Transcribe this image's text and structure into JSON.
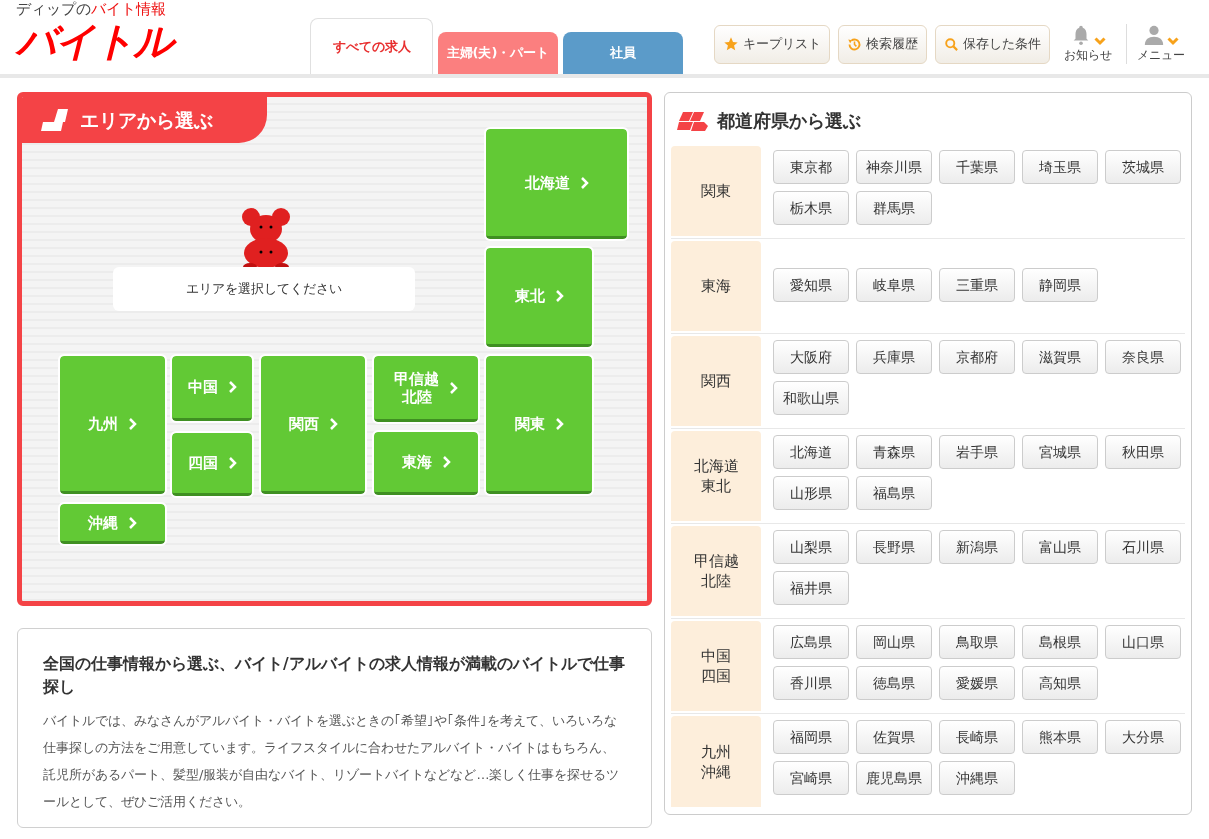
{
  "logo": {
    "tagline_prefix": "ディップの",
    "tagline_accent": "バイト情報",
    "name": "バイトル"
  },
  "tabs": [
    {
      "label": "すべての求人",
      "selected": true,
      "color": "#ffffff"
    },
    {
      "label": "主婦(夫)・パート",
      "selected": false,
      "color": "#fb7f7f"
    },
    {
      "label": "社員",
      "selected": false,
      "color": "#5b9bc9"
    }
  ],
  "header_buttons": [
    {
      "kind": "star",
      "label": "キープリスト"
    },
    {
      "kind": "history",
      "label": "検索履歴"
    },
    {
      "kind": "search",
      "label": "保存した条件"
    }
  ],
  "header_menus": [
    {
      "kind": "bell",
      "label": "お知らせ"
    },
    {
      "kind": "person",
      "label": "メニュー"
    }
  ],
  "area_panel": {
    "title": "エリアから選ぶ",
    "prompt": "エリアを選択してください",
    "areas": [
      {
        "lines": [
          "北海道"
        ]
      },
      {
        "lines": [
          "東北"
        ]
      },
      {
        "lines": [
          "九州"
        ]
      },
      {
        "lines": [
          "中国"
        ]
      },
      {
        "lines": [
          "四国"
        ]
      },
      {
        "lines": [
          "関西"
        ]
      },
      {
        "lines": [
          "甲信越",
          "北陸"
        ]
      },
      {
        "lines": [
          "東海"
        ]
      },
      {
        "lines": [
          "関東"
        ]
      },
      {
        "lines": [
          "沖縄"
        ]
      }
    ]
  },
  "prefecture_panel": {
    "title": "都道府県から選ぶ",
    "regions": [
      {
        "lines": [
          "関東"
        ],
        "prefectures": [
          "東京都",
          "神奈川県",
          "千葉県",
          "埼玉県",
          "茨城県",
          "栃木県",
          "群馬県"
        ]
      },
      {
        "lines": [
          "東海"
        ],
        "prefectures": [
          "愛知県",
          "岐阜県",
          "三重県",
          "静岡県"
        ]
      },
      {
        "lines": [
          "関西"
        ],
        "prefectures": [
          "大阪府",
          "兵庫県",
          "京都府",
          "滋賀県",
          "奈良県",
          "和歌山県"
        ]
      },
      {
        "lines": [
          "北海道",
          "東北"
        ],
        "prefectures": [
          "北海道",
          "青森県",
          "岩手県",
          "宮城県",
          "秋田県",
          "山形県",
          "福島県"
        ]
      },
      {
        "lines": [
          "甲信越",
          "北陸"
        ],
        "prefectures": [
          "山梨県",
          "長野県",
          "新潟県",
          "富山県",
          "石川県",
          "福井県"
        ]
      },
      {
        "lines": [
          "中国",
          "四国"
        ],
        "prefectures": [
          "広島県",
          "岡山県",
          "鳥取県",
          "島根県",
          "山口県",
          "香川県",
          "徳島県",
          "愛媛県",
          "高知県"
        ]
      },
      {
        "lines": [
          "九州",
          "沖縄"
        ],
        "prefectures": [
          "福岡県",
          "佐賀県",
          "長崎県",
          "熊本県",
          "大分県",
          "宮崎県",
          "鹿児島県",
          "沖縄県"
        ]
      }
    ]
  },
  "about": {
    "heading": "全国の仕事情報から選ぶ、バイト/アルバイトの求人情報が満載のバイトルで仕事探し",
    "body": "バイトルでは、みなさんがアルバイト・バイトを選ぶときの｢希望｣や｢条件｣を考えて、いろいろな仕事探しの方法をご用意しています。ライフスタイルに合わせたアルバイト・バイトはもちろん、託児所があるパート、髪型/服装が自由なバイト、リゾートバイトなどなど…楽しく仕事を探せるツールとして、ぜひご活用ください。"
  }
}
